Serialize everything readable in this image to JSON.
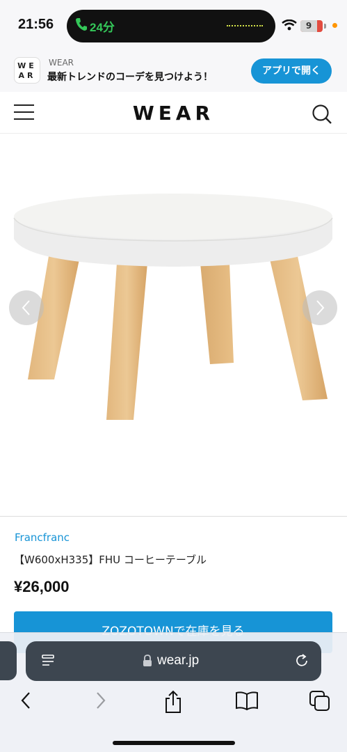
{
  "status_bar": {
    "time": "21:56",
    "call_timer": "24分",
    "battery": "9"
  },
  "app_banner": {
    "logo": "WE AR",
    "app_name": "WEAR",
    "tagline": "最新トレンドのコーデを見つけよう！",
    "open_button": "アプリで開く"
  },
  "header": {
    "logo": "WEAR"
  },
  "product": {
    "brand": "Francfranc",
    "name": "【W600xH335】FHU コーヒーテーブル",
    "price": "¥26,000",
    "stock_button": "ZOZOTOWNで在庫を見る"
  },
  "browser": {
    "url": "wear.jp"
  },
  "colors": {
    "accent": "#1794d6",
    "call_green": "#34c759",
    "battery_red": "#e24b3f"
  },
  "icons": [
    "phone-icon",
    "wifi-icon",
    "battery-icon",
    "menu-icon",
    "search-icon",
    "chevron-left-icon",
    "chevron-right-icon",
    "reader-icon",
    "lock-icon",
    "reload-icon",
    "back-icon",
    "forward-icon",
    "share-icon",
    "bookmarks-icon",
    "tabs-icon"
  ]
}
